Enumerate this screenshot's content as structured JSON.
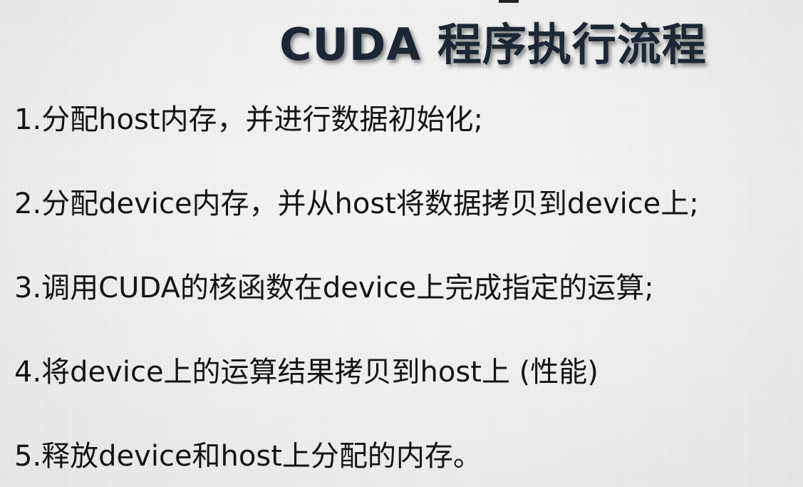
{
  "title": "CUDA 程序执行流程",
  "steps": [
    "1.分配host内存，并进行数据初始化;",
    "2.分配device内存，并从host将数据拷贝到device上;",
    "3.调用CUDA的核函数在device上完成指定的运算;",
    "4.将device上的运算结果拷贝到host上 (性能)",
    "5.释放device和host上分配的内存。"
  ]
}
